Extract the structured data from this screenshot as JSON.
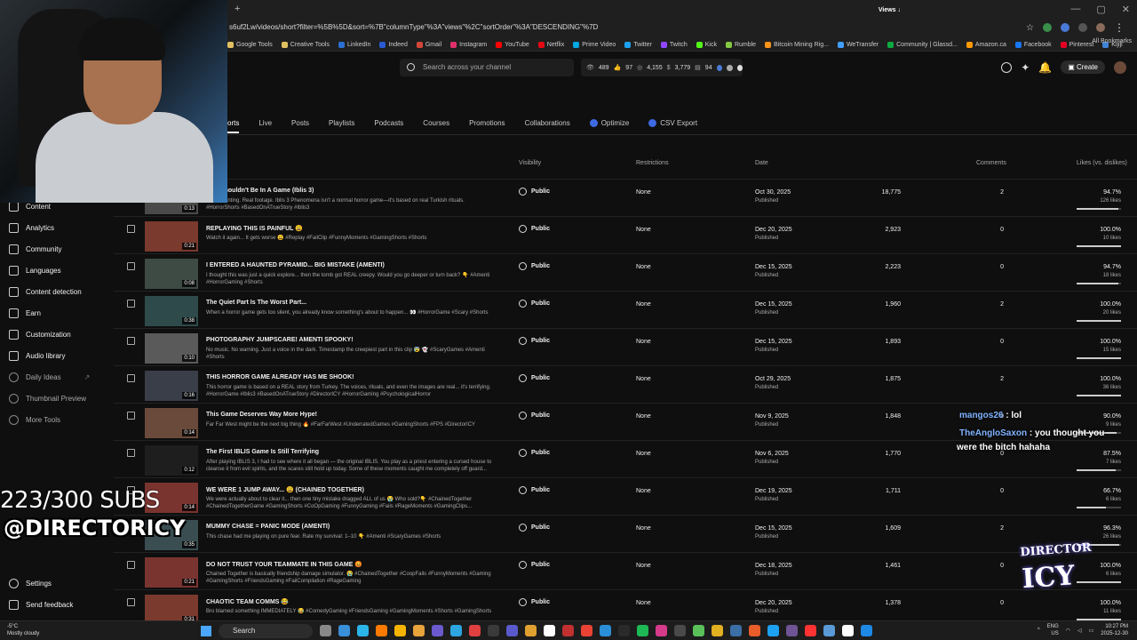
{
  "browser": {
    "url": "s6uf2Lw/videos/short?filter=%5B%5D&sort=%7B\"columnType\"%3A\"views\"%2C\"sortOrder\"%3A\"DESCENDING\"%7D",
    "bookmarks": [
      "Google Tools",
      "Creative Tools",
      "LinkedIn",
      "Indeed",
      "Gmail",
      "Instagram",
      "YouTube",
      "Netflix",
      "Prime Video",
      "Twitter",
      "Twitch",
      "Kick",
      "Rumble",
      "Bitcoin Mining Rig...",
      "WeTransfer",
      "Community | Glassd...",
      "Amazon.ca",
      "Facebook",
      "Pinterest",
      "Kijiji"
    ],
    "bookmark_colors": [
      "#e0c060",
      "#e0c060",
      "#2a6fd1",
      "#2a5ad1",
      "#d44638",
      "#e1306c",
      "#ff0000",
      "#e50914",
      "#00a8e1",
      "#1da1f2",
      "#9146ff",
      "#53fc18",
      "#85c742",
      "#f7931a",
      "#409fff",
      "#0caa41",
      "#ff9900",
      "#1877f2",
      "#e60023",
      "#3f84d6"
    ],
    "all_bookmarks": "All Bookmarks"
  },
  "header": {
    "search_placeholder": "Search across your channel",
    "stats": [
      "489",
      "97",
      "4,155",
      "3,779",
      "94"
    ],
    "create_label": "Create"
  },
  "tabs": [
    {
      "label": "orts",
      "active": true
    },
    {
      "label": "Live"
    },
    {
      "label": "Posts"
    },
    {
      "label": "Playlists"
    },
    {
      "label": "Podcasts"
    },
    {
      "label": "Courses"
    },
    {
      "label": "Promotions"
    },
    {
      "label": "Collaborations"
    },
    {
      "label": "Optimize",
      "badge": true
    },
    {
      "label": "CSV Export",
      "badge": true
    }
  ],
  "sidebar": {
    "items": [
      "Content",
      "Analytics",
      "Community",
      "Languages",
      "Content detection",
      "Earn",
      "Customization",
      "Audio library"
    ],
    "extras": [
      "Daily Ideas",
      "Thumbnail Preview",
      "More Tools"
    ],
    "settings": "Settings",
    "feedback": "Send feedback"
  },
  "columns": {
    "visibility": "Visibility",
    "restrictions": "Restrictions",
    "date": "Date",
    "views": "Views ↓",
    "comments": "Comments",
    "likes": "Likes (vs. dislikes)"
  },
  "rows": [
    {
      "title": "...ne Shouldn't Be In A Game (Iblis 3)",
      "desc": "...ual chanting. Real footage. Iblis 3 Phenomena isn't a normal horror game—it's based on real Turkish rituals. #HorrorShorts #BasedOnATrueStory #Iblis3",
      "duration": "0:13",
      "visibility": "Public",
      "restrictions": "None",
      "date": "Oct 30, 2025",
      "status": "Published",
      "views": "18,775",
      "comments": "2",
      "likes": "94.7%",
      "likes_sub": "126 likes",
      "likes_pct": 94.7,
      "thumb": "#4a4a4a"
    },
    {
      "title": "REPLAYING THIS IS PAINFUL 😩",
      "desc": "Watch it again... It gets worse 😩 #Replay #FailClip #FunnyMoments #GamingShorts #Shorts",
      "duration": "0:21",
      "visibility": "Public",
      "restrictions": "None",
      "date": "Dec 20, 2025",
      "status": "Published",
      "views": "2,923",
      "comments": "0",
      "likes": "100.0%",
      "likes_sub": "10 likes",
      "likes_pct": 100,
      "thumb": "#7a3a2e"
    },
    {
      "title": "I ENTERED A HAUNTED PYRAMID... BIG MISTAKE (AMENTI)",
      "desc": "I thought this was just a quick explore... then the tomb got REAL creepy. Would you go deeper or turn back? 👇 #Amenti #HorrorGaming #Shorts",
      "duration": "0:08",
      "visibility": "Public",
      "restrictions": "None",
      "date": "Dec 15, 2025",
      "status": "Published",
      "views": "2,223",
      "comments": "0",
      "likes": "94.7%",
      "likes_sub": "18 likes",
      "likes_pct": 94.7,
      "thumb": "#3e4a44"
    },
    {
      "title": "The Quiet Part Is The Worst Part...",
      "desc": "When a horror game gets too silent, you already know something's about to happen... 👀 #HorrorGame #Scary #Shorts",
      "duration": "0:38",
      "visibility": "Public",
      "restrictions": "None",
      "date": "Dec 15, 2025",
      "status": "Published",
      "views": "1,960",
      "comments": "2",
      "likes": "100.0%",
      "likes_sub": "20 likes",
      "likes_pct": 100,
      "thumb": "#2e4a4a"
    },
    {
      "title": "PHOTOGRAPHY JUMPSCARE! AMENTI SPOOKY!",
      "desc": "No music. No warning. Just a voice in the dark. Timestamp the creepiest part in this clip 😰 👻 #ScaryGames #Amenti #Shorts",
      "duration": "0:10",
      "visibility": "Public",
      "restrictions": "None",
      "date": "Dec 15, 2025",
      "status": "Published",
      "views": "1,893",
      "comments": "0",
      "likes": "100.0%",
      "likes_sub": "15 likes",
      "likes_pct": 100,
      "thumb": "#5a5a5a"
    },
    {
      "title": "THIS HORROR GAME ALREADY HAS ME SHOOK!",
      "desc": "This horror game is based on a REAL story from Turkey. The voices, rituals, and even the images are real... it's terrifying. #HorrorGame #Iblis3 #BasedOnATrueStory #DirectorICY #HorrorGaming #PsychologicalHorror",
      "duration": "0:16",
      "visibility": "Public",
      "restrictions": "None",
      "date": "Oct 29, 2025",
      "status": "Published",
      "views": "1,875",
      "comments": "2",
      "likes": "100.0%",
      "likes_sub": "36 likes",
      "likes_pct": 100,
      "thumb": "#3a3e48"
    },
    {
      "title": "This Game Deserves Way More Hype!",
      "desc": "Far Far West might be the next big thing 🔥 #FarFarWest #UnderratedGames #GamingShorts #FPS #DirectorICY",
      "duration": "0:14",
      "visibility": "Public",
      "restrictions": "None",
      "date": "Nov 9, 2025",
      "status": "Published",
      "views": "1,848",
      "comments": "0",
      "likes": "90.0%",
      "likes_sub": "9 likes",
      "likes_pct": 90,
      "thumb": "#6a4a3a"
    },
    {
      "title": "The First IBLIS Game Is Still Terrifying",
      "desc": "After playing IBLIS 3, I had to see where it all began — the original IBLIS. You play as a priest entering a cursed house to cleanse it from evil spirits, and the scares still hold up today. Some of these moments caught me completely off guard...",
      "duration": "0:12",
      "visibility": "Public",
      "restrictions": "None",
      "date": "Nov 6, 2025",
      "status": "Published",
      "views": "1,770",
      "comments": "0",
      "likes": "87.5%",
      "likes_sub": "7 likes",
      "likes_pct": 87.5,
      "thumb": "#1e1e1e"
    },
    {
      "title": "WE WERE 1 JUMP AWAY... 😩 (CHAINED TOGETHER)",
      "desc": "We were actually about to clear it... then one tiny mistake dragged ALL of us 😭 Who sold?👇 #ChainedTogether #ChainedTogetherGame #GamingShorts #CoOpGaming #FunnyGaming #Fails #RageMoments #GamingClips...",
      "duration": "0:14",
      "visibility": "Public",
      "restrictions": "None",
      "date": "Dec 19, 2025",
      "status": "Published",
      "views": "1,711",
      "comments": "0",
      "likes": "66.7%",
      "likes_sub": "6 likes",
      "likes_pct": 66.7,
      "thumb": "#7a3430"
    },
    {
      "title": "MUMMY CHASE = PANIC MODE (AMENTI)",
      "desc": "This chase had me playing on pure fear. Rate my survival: 1–10 👇 #Amenti #ScaryGames #Shorts",
      "duration": "0:35",
      "visibility": "Public",
      "restrictions": "None",
      "date": "Dec 15, 2025",
      "status": "Published",
      "views": "1,609",
      "comments": "2",
      "likes": "96.3%",
      "likes_sub": "26 likes",
      "likes_pct": 96.3,
      "thumb": "#3a4e52"
    },
    {
      "title": "DO NOT TRUST YOUR TEAMMATE IN THIS GAME 😡",
      "desc": "Chained Together is basically friendship damage simulator. 😭 #ChainedTogether #CoopFails #FunnyMoments #Gaming #GamingShorts #FriendsGaming #FailCompilation #RageGaming",
      "duration": "0:21",
      "visibility": "Public",
      "restrictions": "None",
      "date": "Dec 18, 2025",
      "status": "Published",
      "views": "1,461",
      "comments": "0",
      "likes": "100.0%",
      "likes_sub": "6 likes",
      "likes_pct": 100,
      "thumb": "#7a3430"
    },
    {
      "title": "CHAOTIC TEAM COMMS 😂",
      "desc": "Bro blamed something IMMEDIATELY 😂 #ComedyGaming #FriendsGaming #GamingMoments #Shorts #GamingShorts",
      "duration": "0:31",
      "visibility": "Public",
      "restrictions": "None",
      "date": "Dec 20, 2025",
      "status": "Published",
      "views": "1,378",
      "comments": "0",
      "likes": "100.0%",
      "likes_sub": "11 likes",
      "likes_pct": 100,
      "thumb": "#7a3a2e"
    }
  ],
  "overlay": {
    "subs": "223/300 SUBS",
    "handle": "@DIRECTORICY",
    "chat": [
      {
        "user": "mangos26",
        "msg": " : lol",
        "color": "#7fb2ff"
      },
      {
        "user": "TheAngloSaxon",
        "msg": " : you thought you",
        "color": "#7fb2ff"
      },
      {
        "user": "",
        "msg": "were the bitch hahaha",
        "color": "#fff"
      }
    ],
    "logo_top": "DIRECTOR",
    "logo_bottom": "ICY"
  },
  "taskbar": {
    "temp": "-5°C",
    "weather": "Mostly cloudy",
    "search": "Search",
    "lang": "ENG",
    "region": "US",
    "time": "10:27 PM",
    "date": "2025-12-30",
    "app_colors": [
      "#888",
      "#3a8fd9",
      "#2bb5e8",
      "#ff7a00",
      "#f7b500",
      "#e8a33a",
      "#6a5acd",
      "#2ca5e0",
      "#e04040",
      "#3a3a3a",
      "#5a5acd",
      "#e0a030",
      "#ffffff",
      "#c23030",
      "#ea4335",
      "#2a8fd6",
      "#2a2a2a",
      "#1db954",
      "#d63a8a",
      "#4a4a4a",
      "#5ac05a",
      "#e0b020",
      "#3a6ea5",
      "#e85d2a",
      "#1da1f2",
      "#6e5494",
      "#ff3333",
      "#5a9ad6",
      "#ffffff",
      "#1e88e5",
      "#4a4a4a",
      "#e91e63",
      "#aaaaaa",
      "#cccccc"
    ]
  }
}
